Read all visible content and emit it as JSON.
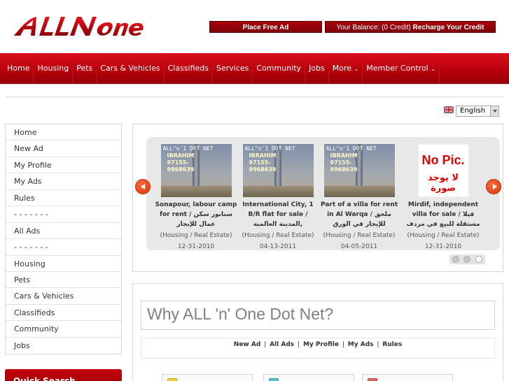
{
  "header": {
    "brand": "ALLNOne",
    "place_ad_label": "Place Free Ad",
    "balance_label": "Your Balance: (0 Credit)",
    "recharge_label": "Recharge Your Credit"
  },
  "nav": {
    "items": [
      "Home",
      "Housing",
      "Pets",
      "Cars & Vehicles",
      "Classifieds",
      "Services",
      "Community",
      "Jobs",
      "More",
      "Member Control"
    ]
  },
  "language": {
    "selected": "English"
  },
  "sidebar": {
    "items": [
      "Home",
      "New Ad",
      "My Profile",
      "My Ads",
      "Rules",
      "- - - - - - -",
      "All Ads",
      "- - - - - - -",
      "Housing",
      "Pets",
      "Cars & Vehicles",
      "Classifieds",
      "Community",
      "Jobs"
    ],
    "quick_search_label": "Quick Search"
  },
  "slides": [
    {
      "thumb_brand": "ALL\"n'1 DOT NET",
      "thumb_name": "IBRAHIM",
      "thumb_phone1": "97155-",
      "thumb_phone2": "9968639",
      "title": "Sonapour, labour camp for rent / سنابور سكن عمال للإيجار",
      "category": "(Housing / Real Estate)",
      "date": "12-31-2010"
    },
    {
      "thumb_brand": "ALL\"n'1 DOT NET",
      "thumb_name": "IBRAHIM",
      "thumb_phone1": "97155-",
      "thumb_phone2": "9968639",
      "title": "International City, 1 B/R flat for sale / المدينة العالمية,",
      "category": "(Housing / Real Estate)",
      "date": "04-13-2011"
    },
    {
      "thumb_brand": "ALL\"n'1 DOT NET",
      "thumb_name": "IBRAHIM",
      "thumb_phone1": "97155-",
      "thumb_phone2": "9968639",
      "title": "Part of a villa for rent in Al Warqa / ملحق للإيجار في الورق",
      "category": "(Housing / Real Estate)",
      "date": "04-05-2011"
    },
    {
      "nopic_en": "No Pic.",
      "nopic_ar": "لا يوجد صورة",
      "title": "Mirdif, independent villa for sale / فيلا مستقلة للبيع في مردف",
      "category": "(Housing / Real Estate)",
      "date": "12-31-2010"
    }
  ],
  "why": {
    "title": "Why ALL 'n' One Dot Net?",
    "links": [
      "New Ad",
      "All Ads",
      "My Profile",
      "My Ads",
      "Rules"
    ],
    "separator": "|"
  },
  "colors": {
    "nav_red": "#c4000d",
    "header_button": "#8a0009",
    "arrow_orange": "#e8501a"
  }
}
